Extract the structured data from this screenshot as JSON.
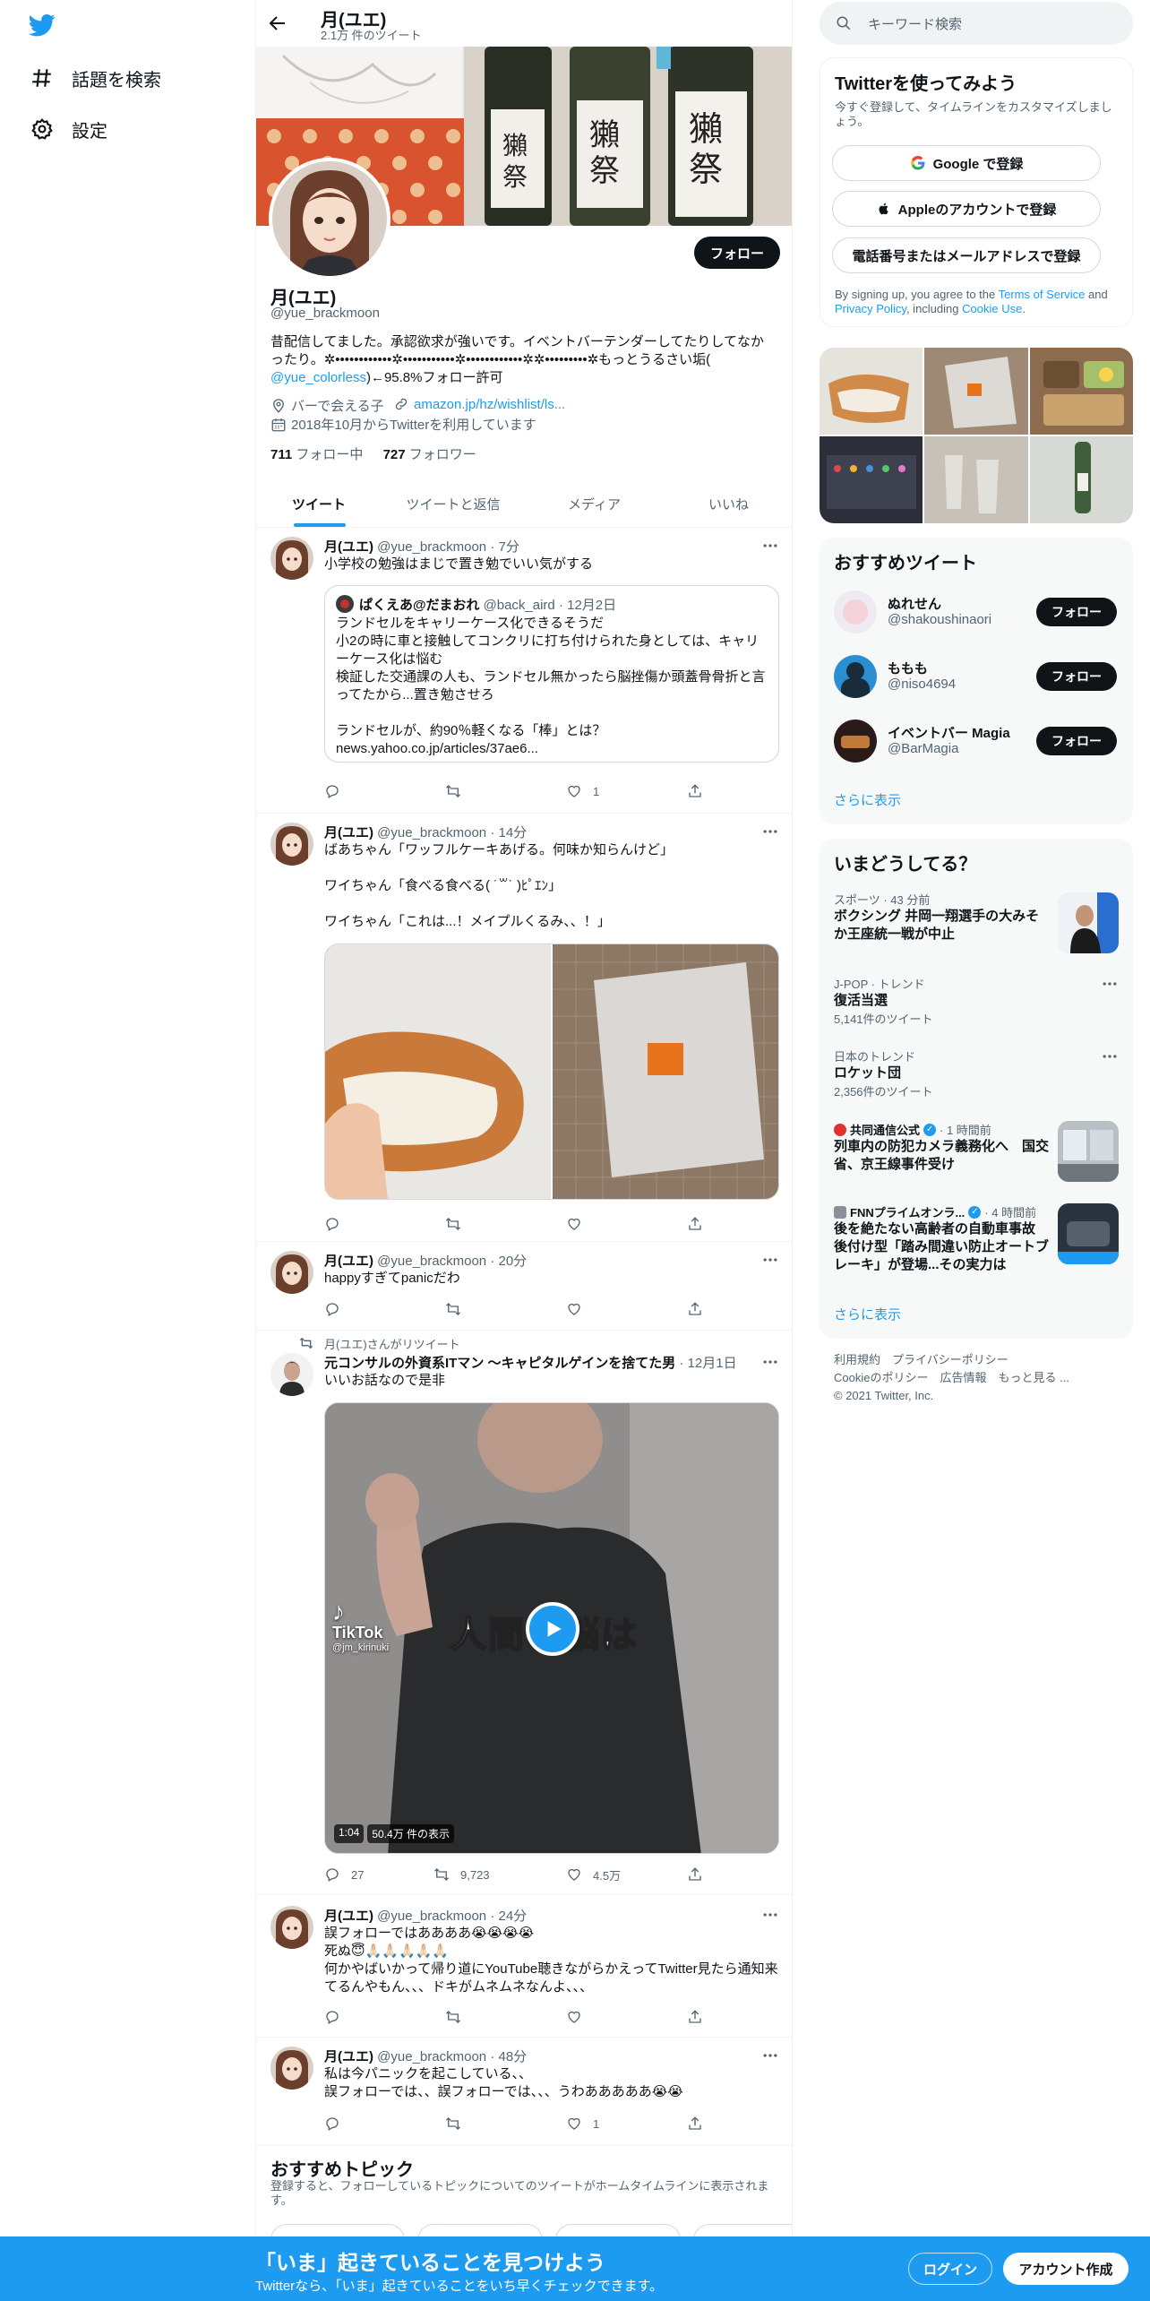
{
  "nav": {
    "explore_label": "話題を検索",
    "settings_label": "設定"
  },
  "header": {
    "title": "月(ユエ)",
    "tweet_count": "2.1万 件のツイート"
  },
  "profile": {
    "name": "月(ユエ)",
    "handle": "@yue_brackmoon",
    "follow_label": "フォロー",
    "bio_line1": "昔配信してました。承認欲求が強いです。イベントバーテンダーしてたりしてなか",
    "bio_line2": "ったり。✲••••••••••••✲•••••••••••✲••••••••••••✲✲•••••••••✲もっとうるさい垢(",
    "bio_link": "@yue_colorless",
    "bio_line3_rest": ")←95.8%フォロー許可",
    "location": "バーで会える子",
    "url": "amazon.jp/hz/wishlist/ls...",
    "joined": "2018年10月からTwitterを利用しています",
    "following_count": "711",
    "following_label": "フォロー中",
    "followers_count": "727",
    "followers_label": "フォロワー"
  },
  "tabs": [
    "ツイート",
    "ツイートと返信",
    "メディア",
    "いいね"
  ],
  "tweets": [
    {
      "name": "月(ユエ)",
      "handle": "@yue_brackmoon",
      "time": "· 7分",
      "text": "小学校の勉強はまじで置き勉でいい気がする",
      "quote": {
        "name": "ぱくえあ@だまおれ",
        "handle": "@back_aird",
        "time": "· 12月2日",
        "text": "ランドセルをキャリーケース化できるそうだ\n小2の時に車と接触してコンクリに打ち付けられた身としては、キャリーケース化は悩む\n検証した交通課の人も、ランドセル無かったら脳挫傷か頭蓋骨骨折と言ってたから...置き勉させろ\n\nランドセルが、約90％軽くなる「棒」とは？\nnews.yahoo.co.jp/articles/37ae6..."
      },
      "like_count": "1"
    },
    {
      "name": "月(ユエ)",
      "handle": "@yue_brackmoon",
      "time": "· 14分",
      "text": "ばあちゃん「ワッフルケーキあげる。何味か知らんけど」\n\nワイちゃん「食べる食べる( ˙꒳˙ )ﾋﾟｴﾝ」\n\nワイちゃん「これは...！メイプルくるみ、、！」"
    },
    {
      "name": "月(ユエ)",
      "handle": "@yue_brackmoon",
      "time": "· 20分",
      "text": "happyすぎてpanicだわ"
    },
    {
      "retweet_label": "月(ユエ)さんがリツイート",
      "name": "元コンサルの外資系ITマン 〜キャピタルゲインを捨てた男",
      "time": "· 12月1日",
      "text": "いいお話なので是非",
      "video_duration": "1:04",
      "video_views": "50.4万 件の表示",
      "video_caption": "人間の脳は",
      "tiktok_label": "TikTok",
      "tiktok_user": "@jm_kirinuki",
      "reply_count": "27",
      "retweet_count": "9,723",
      "like_count": "4.5万"
    },
    {
      "name": "月(ユエ)",
      "handle": "@yue_brackmoon",
      "time": "· 24分",
      "text": "誤フォローではああああ😭😭😭😭\n死ぬ😇🙏🏻🙏🏻🙏🏻🙏🏻🙏🏻\n何かやばいかって帰り道にYouTube聴きながらかえってTwitter見たら通知来てるんやもん、、、ドキがムネムネなんよ、、、"
    },
    {
      "name": "月(ユエ)",
      "handle": "@yue_brackmoon",
      "time": "· 48分",
      "text": "私は今パニックを起こしている、、\n誤フォローでは、、誤フォローでは、、、うわあああああ😭😭",
      "like_count": "1"
    }
  ],
  "topics": {
    "title": "おすすめトピック",
    "description": "登録すると、フォローしているトピックについてのツイートがホームタイムラインに表示されます。"
  },
  "right": {
    "search_placeholder": "キーワード検索",
    "signup": {
      "title": "Twitterを使ってみよう",
      "subtitle": "今すぐ登録して、タイムラインをカスタマイズしましょう。",
      "google_label": "Google で登録",
      "apple_label": "Appleのアカウントで登録",
      "phone_label": "電話番号またはメールアドレスで登録",
      "terms_prefix": "By signing up, you agree to the ",
      "terms_link": "Terms of Service",
      "terms_and": " and ",
      "privacy_link": "Privacy Policy",
      "terms_including": ", including ",
      "cookie_link": "Cookie Use",
      "terms_end": "."
    },
    "who_to_follow": {
      "title": "おすすめツイート",
      "follow_label": "フォロー",
      "users": [
        {
          "name": "ぬれせん",
          "handle": "@shakoushinaori"
        },
        {
          "name": "ももも",
          "handle": "@niso4694"
        },
        {
          "name": "イベントバー Magia",
          "handle": "@BarMagia"
        }
      ],
      "show_more": "さらに表示"
    },
    "trends": {
      "title": "いまどうしてる？",
      "items": [
        {
          "meta": "スポーツ · 43 分前",
          "title": "ボクシング 井岡一翔選手の大みそか王座統一戦が中止"
        },
        {
          "meta": "J-POP · トレンド",
          "title": "復活当選",
          "count": "5,141件のツイート"
        },
        {
          "meta": "日本のトレンド",
          "title": "ロケット団",
          "count": "2,356件のツイート"
        },
        {
          "source": "共同通信公式",
          "time": "· 1 時間前",
          "title": "列車内の防犯カメラ義務化へ　国交省、京王線事件受け"
        },
        {
          "source": "FNNプライムオンラ...",
          "time": "· 4 時間前",
          "title": "後を絶たない高齢者の自動車事故　後付け型「踏み間違い防止オートブレーキ」が登場...その実力は"
        }
      ],
      "show_more": "さらに表示"
    },
    "footer": {
      "line1": "利用規約　プライバシーポリシー",
      "line2": "Cookieのポリシー　広告情報　もっと見る ...",
      "line3": "© 2021 Twitter, Inc."
    }
  },
  "bottom_bar": {
    "title": "「いま」起きていることを見つけよう",
    "subtitle": "Twitterなら、「いま」起きていることをいち早くチェックできます。",
    "login_label": "ログイン",
    "signup_label": "アカウント作成"
  },
  "colors": {
    "accent": "#1d9bf0",
    "text": "#0f1419",
    "muted": "#536471",
    "border": "#eff3f4"
  }
}
